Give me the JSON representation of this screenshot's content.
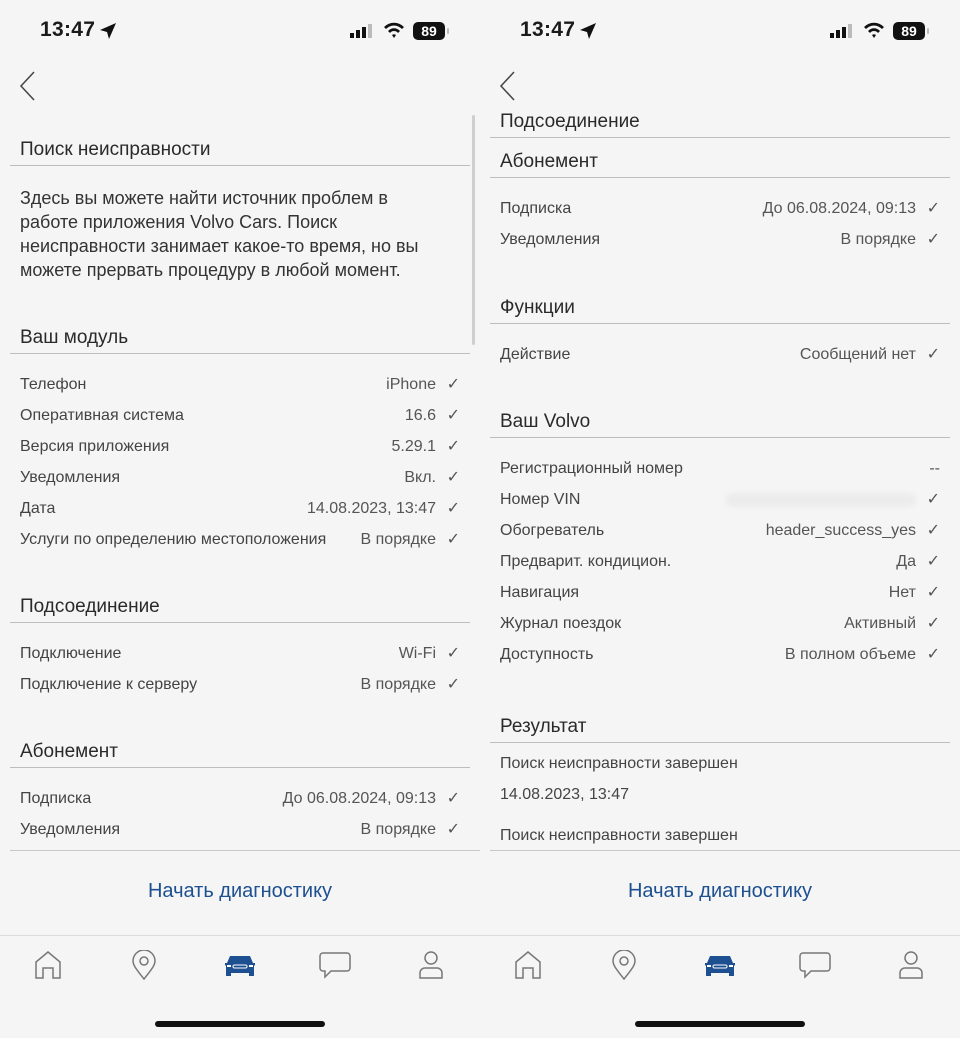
{
  "status_bar": {
    "time": "13:47",
    "battery": "89"
  },
  "accent_color": "#1d4f91",
  "left": {
    "troubleshoot": {
      "title": "Поиск неисправности",
      "description": "Здесь вы можете найти источник проблем в работе приложения Volvo Cars. Поиск неисправности занимает какое-то время, но вы можете прервать процедуру в любой момент."
    },
    "module": {
      "title": "Ваш модуль",
      "rows": [
        {
          "label": "Телефон",
          "value": "iPhone"
        },
        {
          "label": "Оперативная система",
          "value": "16.6"
        },
        {
          "label": "Версия приложения",
          "value": "5.29.1"
        },
        {
          "label": "Уведомления",
          "value": "Вкл."
        },
        {
          "label": "Дата",
          "value": "14.08.2023, 13:47"
        },
        {
          "label": "Услуги по определению местоположения",
          "value": "В порядке"
        }
      ]
    },
    "connection": {
      "title": "Подсоединение",
      "rows": [
        {
          "label": "Подключение",
          "value": "Wi-Fi"
        },
        {
          "label": "Подключение к серверу",
          "value": "В порядке"
        }
      ]
    },
    "subscription": {
      "title": "Абонемент",
      "rows": [
        {
          "label": "Подписка",
          "value": "До 06.08.2024, 09:13"
        },
        {
          "label": "Уведомления",
          "value": "В порядке"
        }
      ]
    }
  },
  "right": {
    "connection": {
      "title": "Подсоединение"
    },
    "subscription": {
      "title": "Абонемент",
      "rows": [
        {
          "label": "Подписка",
          "value": "До 06.08.2024, 09:13"
        },
        {
          "label": "Уведомления",
          "value": "В порядке"
        }
      ]
    },
    "functions": {
      "title": "Функции",
      "rows": [
        {
          "label": "Действие",
          "value": "Сообщений нет"
        }
      ]
    },
    "volvo": {
      "title": "Ваш Volvo",
      "rows": [
        {
          "label": "Регистрационный номер",
          "value": "--"
        },
        {
          "label": "Номер VIN",
          "value": ""
        },
        {
          "label": "Обогреватель",
          "value": "header_success_yes"
        },
        {
          "label": "Предварит. кондицион.",
          "value": "Да"
        },
        {
          "label": "Навигация",
          "value": "Нет"
        },
        {
          "label": "Журнал поездок",
          "value": "Активный"
        },
        {
          "label": "Доступность",
          "value": "В полном объеме"
        }
      ]
    },
    "result": {
      "title": "Результат",
      "lines": [
        "Поиск неисправности завершен",
        "14.08.2023, 13:47",
        "Поиск неисправности завершен"
      ]
    }
  },
  "check_mark": "✓",
  "action_label": "Начать диагностику",
  "tabs": [
    {
      "icon": "home-icon"
    },
    {
      "icon": "location-pin-icon"
    },
    {
      "icon": "car-icon",
      "active": true
    },
    {
      "icon": "chat-icon"
    },
    {
      "icon": "profile-icon"
    }
  ]
}
